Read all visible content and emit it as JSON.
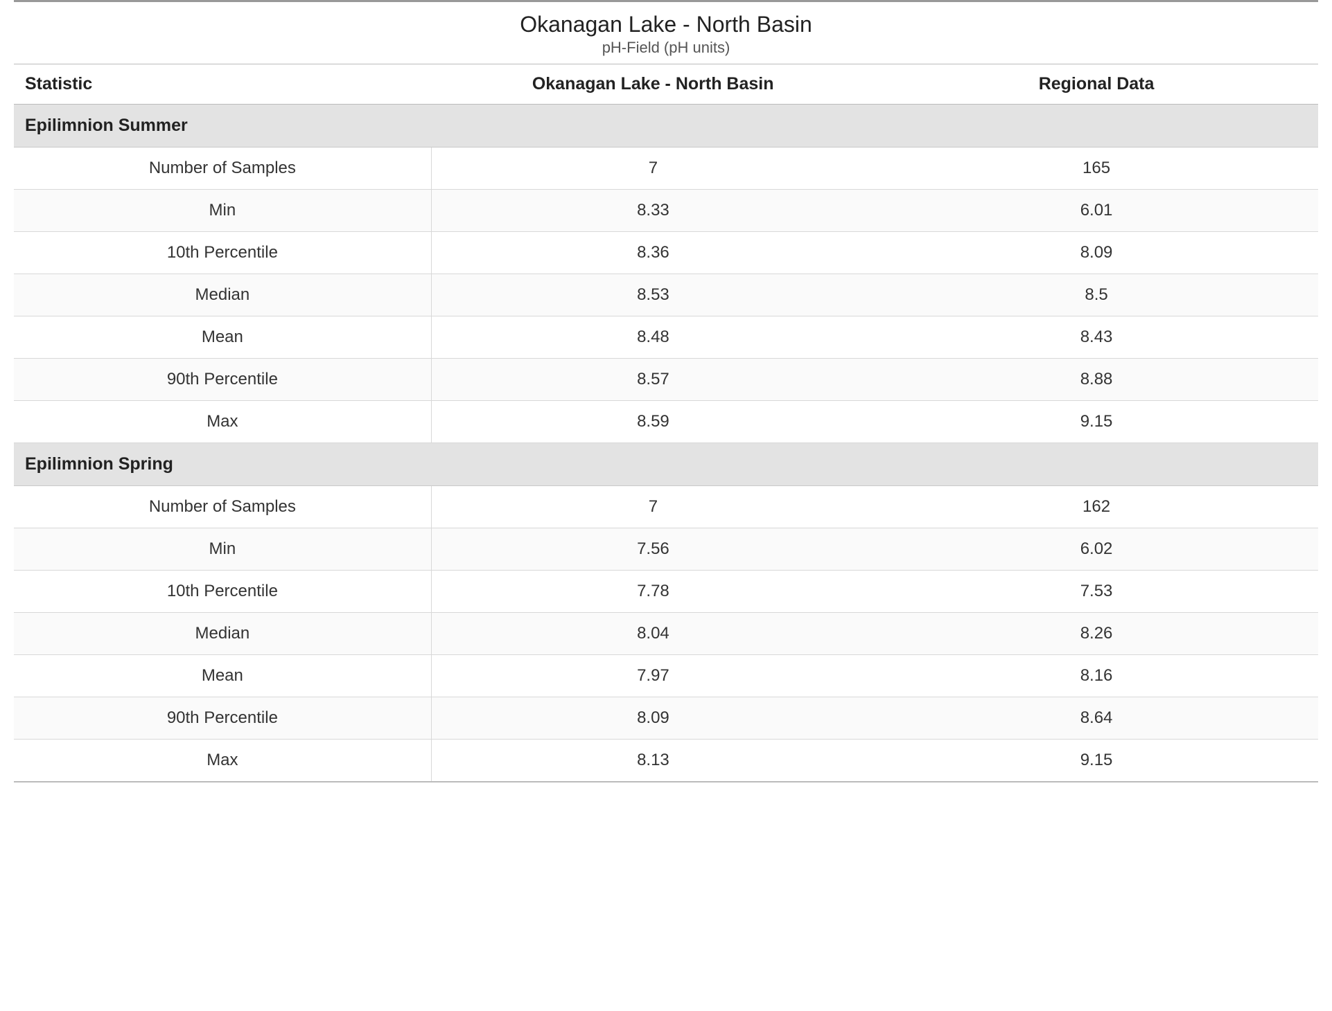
{
  "header": {
    "title": "Okanagan Lake - North Basin",
    "subtitle": "pH-Field (pH units)"
  },
  "columns": {
    "stat_label": "Statistic",
    "local_label": "Okanagan Lake - North Basin",
    "regional_label": "Regional Data"
  },
  "chart_data": {
    "type": "table",
    "title": "Okanagan Lake - North Basin — pH-Field (pH units)",
    "columns": [
      "Statistic",
      "Okanagan Lake - North Basin",
      "Regional Data"
    ],
    "sections": [
      {
        "name": "Epilimnion Summer",
        "rows": [
          {
            "stat": "Number of Samples",
            "local": "7",
            "regional": "165"
          },
          {
            "stat": "Min",
            "local": "8.33",
            "regional": "6.01"
          },
          {
            "stat": "10th Percentile",
            "local": "8.36",
            "regional": "8.09"
          },
          {
            "stat": "Median",
            "local": "8.53",
            "regional": "8.5"
          },
          {
            "stat": "Mean",
            "local": "8.48",
            "regional": "8.43"
          },
          {
            "stat": "90th Percentile",
            "local": "8.57",
            "regional": "8.88"
          },
          {
            "stat": "Max",
            "local": "8.59",
            "regional": "9.15"
          }
        ]
      },
      {
        "name": "Epilimnion Spring",
        "rows": [
          {
            "stat": "Number of Samples",
            "local": "7",
            "regional": "162"
          },
          {
            "stat": "Min",
            "local": "7.56",
            "regional": "6.02"
          },
          {
            "stat": "10th Percentile",
            "local": "7.78",
            "regional": "7.53"
          },
          {
            "stat": "Median",
            "local": "8.04",
            "regional": "8.26"
          },
          {
            "stat": "Mean",
            "local": "7.97",
            "regional": "8.16"
          },
          {
            "stat": "90th Percentile",
            "local": "8.09",
            "regional": "8.64"
          },
          {
            "stat": "Max",
            "local": "8.13",
            "regional": "9.15"
          }
        ]
      }
    ]
  }
}
